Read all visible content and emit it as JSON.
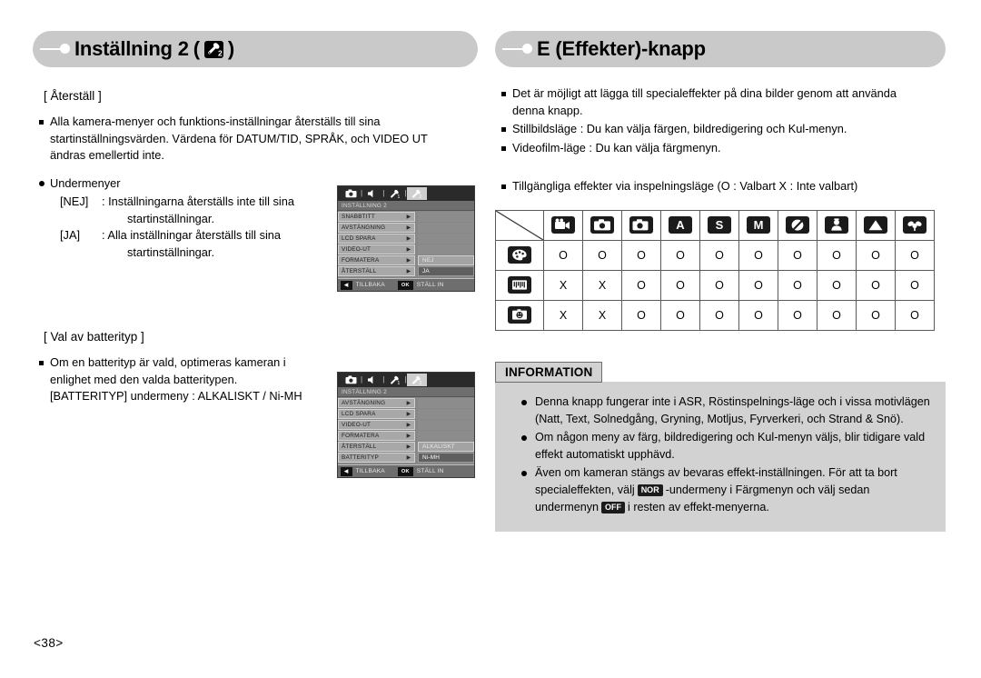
{
  "page_number": "<38>",
  "left": {
    "header": {
      "title_pre": "Inställning 2",
      "paren_open": "(",
      "paren_close": ")",
      "icon": "wrench-2-icon"
    },
    "section_reset": {
      "heading": "[ Återställ ]",
      "bullet1_line1": "Alla kamera-menyer och funktions-inställningar återställs till sina",
      "bullet1_line2": "startinställningsvärden. Värdena för DATUM/TID, SPRÅK, och VIDEO UT",
      "bullet1_line3": "ändras emellertid inte.",
      "bullet2_label": "Undermenyer",
      "sub1_key": "[NEJ]",
      "sub1_sep": ":",
      "sub1_line1": "Inställningarna återställs inte till sina",
      "sub1_line2": "startinställningar.",
      "sub2_key": "[JA]",
      "sub2_sep": ":",
      "sub2_line1": "Alla inställningar återställs till sina",
      "sub2_line2": "startinställningar."
    },
    "section_battery": {
      "heading": "[ Val av batterityp ]",
      "bullet1_line1": "Om en batterityp är vald, optimeras kameran i",
      "bullet1_line2": "enlighet med den valda batteritypen.",
      "bullet1_line3": "[BATTERITYP] undermeny : ALKALISKT / Ni-MH"
    },
    "lcd_reset": {
      "tabs": [
        "camera-icon",
        "speaker-icon",
        "wrench-1-icon",
        "wrench-2-icon"
      ],
      "selected_tab_index": 3,
      "title": "INSTÄLLNING 2",
      "rows": [
        {
          "label": "SNABBTITT",
          "arrow": "▶",
          "submenu": "",
          "submenu_style": "none"
        },
        {
          "label": "AVSTÄNGNING",
          "arrow": "▶",
          "submenu": "",
          "submenu_style": "none"
        },
        {
          "label": "LCD SPARA",
          "arrow": "▶",
          "submenu": "",
          "submenu_style": "none"
        },
        {
          "label": "VIDEO-UT",
          "arrow": "▶",
          "submenu": "",
          "submenu_style": "none"
        },
        {
          "label": "FORMATERA",
          "arrow": "▶",
          "submenu": "NEJ",
          "submenu_style": "boxed"
        },
        {
          "label": "ÅTERSTÄLL",
          "arrow": "▶",
          "submenu": "JA",
          "submenu_style": "hl"
        }
      ],
      "footer": {
        "back_key": "◀",
        "back_label": "TILLBAKA",
        "ok_key": "OK",
        "ok_label": "STÄLL IN"
      }
    },
    "lcd_battery": {
      "tabs": [
        "camera-icon",
        "speaker-icon",
        "wrench-1-icon",
        "wrench-2-icon"
      ],
      "selected_tab_index": 3,
      "title": "INSTÄLLNING 2",
      "rows": [
        {
          "label": "AVSTÄNGNING",
          "arrow": "▶",
          "submenu": "",
          "submenu_style": "none"
        },
        {
          "label": "LCD SPARA",
          "arrow": "▶",
          "submenu": "",
          "submenu_style": "none"
        },
        {
          "label": "VIDEO-UT",
          "arrow": "▶",
          "submenu": "",
          "submenu_style": "none"
        },
        {
          "label": "FORMATERA",
          "arrow": "▶",
          "submenu": "",
          "submenu_style": "none"
        },
        {
          "label": "ÅTERSTÄLL",
          "arrow": "▶",
          "submenu": "ALKALISKT",
          "submenu_style": "boxed"
        },
        {
          "label": "BATTERITYP",
          "arrow": "▶",
          "submenu": "Ni-MH",
          "submenu_style": "hl"
        }
      ],
      "footer": {
        "back_key": "◀",
        "back_label": "TILLBAKA",
        "ok_key": "OK",
        "ok_label": "STÄLL IN"
      }
    }
  },
  "right": {
    "header": {
      "title": "E (Effekter)-knapp"
    },
    "bullets": [
      {
        "line1": "Det är möjligt att lägga till specialeffekter på dina bilder genom att använda",
        "line2": "denna knapp."
      },
      {
        "line1": "Stillbildsläge : Du kan välja färgen, bildredigering och Kul-menyn.",
        "line2": ""
      },
      {
        "line1": "Videofilm-läge : Du kan välja färgmenyn.",
        "line2": ""
      }
    ],
    "table_intro": "Tillgängliga effekter via inspelningsläge (O : Valbart X : Inte valbart)",
    "information": {
      "label": "INFORMATION",
      "items": [
        {
          "parts": [
            {
              "type": "text",
              "value": "Denna knapp fungerar inte i ASR, Röstinspelnings-läge och i vissa motivlägen (Natt, Text, Solnedgång, Gryning, Motljus, Fyrverkeri, och Strand & Snö)."
            }
          ]
        },
        {
          "parts": [
            {
              "type": "text",
              "value": "Om någon meny av färg, bildredigering och Kul-menyn väljs, blir tidigare vald effekt automatiskt upphävd."
            }
          ]
        },
        {
          "parts": [
            {
              "type": "text",
              "value": "Även om kameran stängs av bevaras effekt-inställningen. För att ta bort specialeffekten, välj"
            },
            {
              "type": "kbd",
              "value": "NOR"
            },
            {
              "type": "text",
              "value": "-undermeny i Färgmenyn och välj sedan undermenyn"
            },
            {
              "type": "kbd",
              "value": "OFF"
            },
            {
              "type": "text",
              "value": "i resten av effekt-menyerna."
            }
          ]
        }
      ]
    }
  },
  "chart_data": {
    "type": "table",
    "title": "Tillgängliga effekter via inspelningsläge (O : Valbart X : Inte valbart)",
    "corner": "",
    "categories": [
      "movie-mode-icon",
      "auto-mode-icon",
      "program-mode-icon",
      "aperture-priority-mode-icon",
      "shutter-priority-mode-icon",
      "manual-mode-icon",
      "asr-mode-icon",
      "portrait-mode-icon",
      "landscape-mode-icon",
      "macro-mode-icon"
    ],
    "category_labels": [
      "",
      "",
      "",
      "A",
      "S",
      "M",
      "",
      "",
      "",
      ""
    ],
    "rows": [
      {
        "icon": "color-palette-icon",
        "values": [
          "O",
          "O",
          "O",
          "O",
          "O",
          "O",
          "O",
          "O",
          "O",
          "O"
        ]
      },
      {
        "icon": "image-edit-icon",
        "values": [
          "X",
          "X",
          "O",
          "O",
          "O",
          "O",
          "O",
          "O",
          "O",
          "O"
        ]
      },
      {
        "icon": "fun-smiley-icon",
        "values": [
          "X",
          "X",
          "O",
          "O",
          "O",
          "O",
          "O",
          "O",
          "O",
          "O"
        ]
      }
    ]
  }
}
